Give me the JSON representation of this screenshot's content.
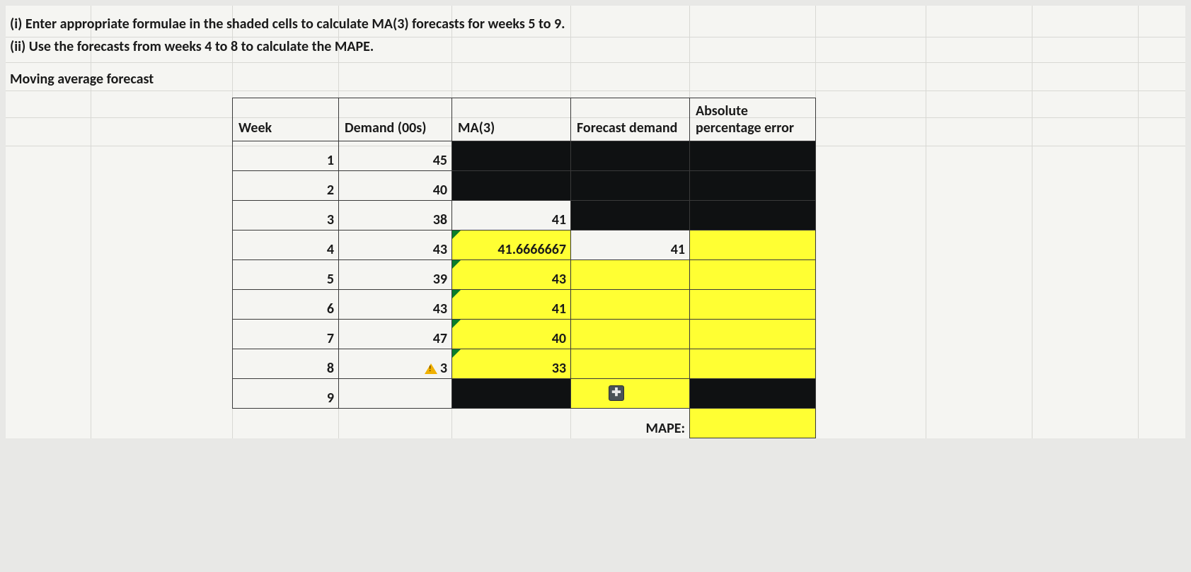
{
  "instructions": {
    "line1": "(i) Enter appropriate formulae in the shaded cells to calculate MA(3) forecasts  for weeks 5 to 9.",
    "line2": "(ii) Use the forecasts from weeks 4 to 8 to calculate the MAPE."
  },
  "section_title": "Moving average forecast",
  "headers": {
    "week": "Week",
    "demand": "Demand (00s)",
    "ma3": "MA(3)",
    "forecast_demand": "Forecast demand",
    "ape": "Absolute percentage error"
  },
  "rows": [
    {
      "week": "1",
      "demand": "45",
      "ma3": "",
      "fd": "",
      "ape": "",
      "ma3_class": "black-cell",
      "fd_class": "black-cell",
      "ape_class": "black-cell"
    },
    {
      "week": "2",
      "demand": "40",
      "ma3": "",
      "fd": "",
      "ape": "",
      "ma3_class": "black-cell",
      "fd_class": "black-cell",
      "ape_class": "black-cell"
    },
    {
      "week": "3",
      "demand": "38",
      "ma3": "41",
      "fd": "",
      "ape": "",
      "ma3_class": "",
      "fd_class": "black-cell",
      "ape_class": "black-cell"
    },
    {
      "week": "4",
      "demand": "43",
      "ma3": "41.6666667",
      "fd": "41",
      "ape": "",
      "ma3_class": "yellow-cell corner-flag",
      "fd_class": "",
      "ape_class": "yellow-cell"
    },
    {
      "week": "5",
      "demand": "39",
      "ma3": "43",
      "fd": "",
      "ape": "",
      "ma3_class": "yellow-cell corner-flag",
      "fd_class": "yellow-cell",
      "ape_class": "yellow-cell"
    },
    {
      "week": "6",
      "demand": "43",
      "ma3": "41",
      "fd": "",
      "ape": "",
      "ma3_class": "yellow-cell corner-flag",
      "fd_class": "yellow-cell",
      "ape_class": "yellow-cell"
    },
    {
      "week": "7",
      "demand": "47",
      "ma3": "40",
      "fd": "",
      "ape": "",
      "ma3_class": "yellow-cell corner-flag",
      "fd_class": "yellow-cell",
      "ape_class": "yellow-cell"
    },
    {
      "week": "8",
      "demand": "3",
      "ma3": "33",
      "fd": "",
      "ape": "",
      "ma3_class": "yellow-cell corner-flag",
      "fd_class": "yellow-cell",
      "ape_class": "yellow-cell",
      "warn": true
    },
    {
      "week": "9",
      "demand": "",
      "ma3": "",
      "fd": "",
      "ape": "",
      "ma3_class": "black-cell",
      "fd_class": "yellow-cell",
      "ape_class": "black-cell",
      "plus": true
    }
  ],
  "mape_label": "MAPE:",
  "chart_data": {
    "type": "table",
    "title": "Moving average forecast",
    "columns": [
      "Week",
      "Demand (00s)",
      "MA(3)",
      "Forecast demand",
      "Absolute percentage error"
    ],
    "rows": [
      [
        1,
        45,
        null,
        null,
        null
      ],
      [
        2,
        40,
        null,
        null,
        null
      ],
      [
        3,
        38,
        41,
        null,
        null
      ],
      [
        4,
        43,
        41.6666667,
        41,
        null
      ],
      [
        5,
        39,
        43,
        null,
        null
      ],
      [
        6,
        43,
        41,
        null,
        null
      ],
      [
        7,
        47,
        40,
        null,
        null
      ],
      [
        8,
        3,
        33,
        null,
        null
      ],
      [
        9,
        null,
        null,
        null,
        null
      ]
    ],
    "summary": {
      "MAPE": null
    }
  }
}
